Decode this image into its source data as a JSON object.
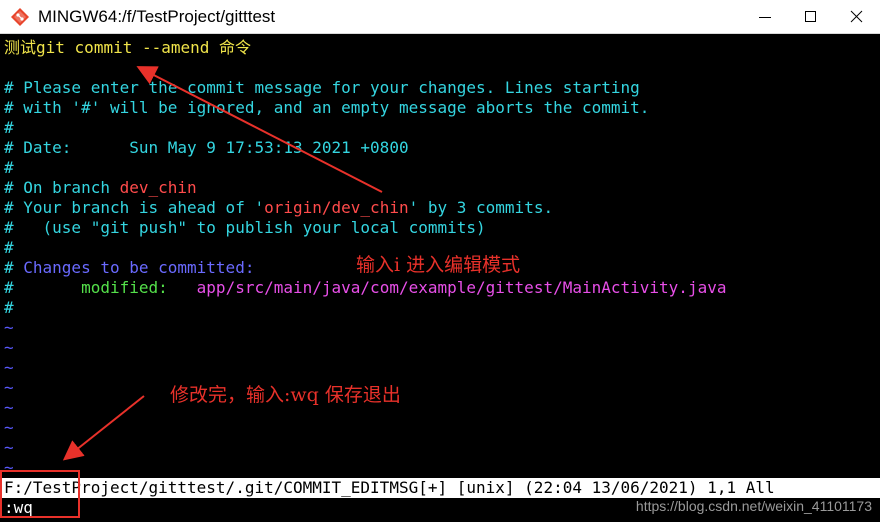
{
  "window": {
    "title": "MINGW64:/f/TestProject/gitttest",
    "minimize_label": "minimize",
    "maximize_label": "maximize",
    "close_label": "close"
  },
  "terminal": {
    "header_cn": "测试",
    "header_cmd": "git commit --amend",
    "header_cn2": "命令",
    "lines": {
      "l1": "# Please enter the commit message for your changes. Lines starting",
      "l2": "# with '#' will be ignored, and an empty message aborts the commit.",
      "l3": "#",
      "l4": "# Date:      Sun May 9 17:53:13 2021 +0800",
      "l5": "#",
      "l6a": "# On branch ",
      "l6b": "dev_chin",
      "l7a": "# Your branch is ahead of '",
      "l7b": "origin/dev_chin",
      "l7c": "' by 3 commits.",
      "l8": "#   (use \"git push\" to publish your local commits)",
      "l9": "#",
      "l10a": "# ",
      "l10b": "Changes to be committed:",
      "l11a": "#       ",
      "l11b": "modified:",
      "l11c": "   app/src/main/java/com/example/gittest/MainActivity.java",
      "l12": "#"
    },
    "tilde": "~",
    "status_line": "F:/TestProject/gitttest/.git/COMMIT_EDITMSG[+] [unix] (22:04 13/06/2021) 1,1 All",
    "command_line": ":wq"
  },
  "annotations": {
    "insert_mode": "输入i 进入编辑模式",
    "save_quit": "修改完，输入:wq 保存退出"
  },
  "watermark": "https://blog.csdn.net/weixin_41101173",
  "colors": {
    "comment": "#34d5e0",
    "branch": "#ff4b4b",
    "annotation": "#e8312a",
    "modified": "#54e04a",
    "path": "#e84fe8"
  }
}
